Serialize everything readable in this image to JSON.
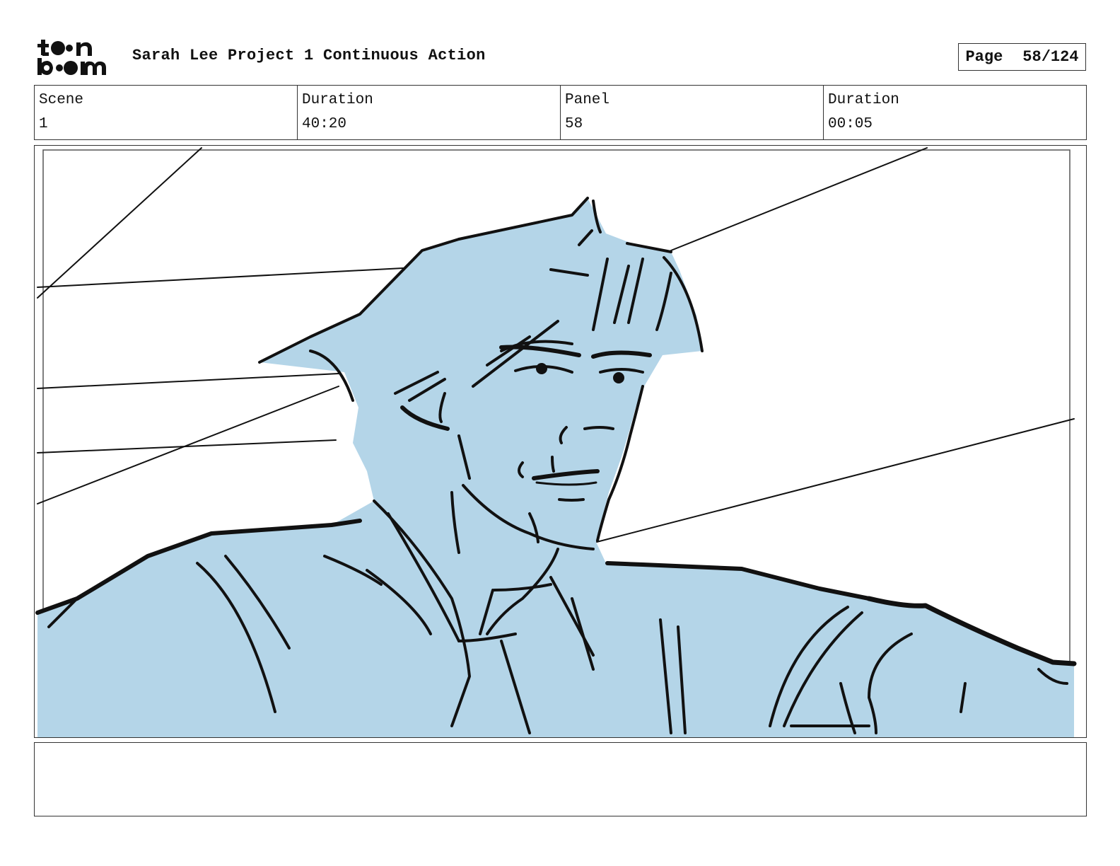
{
  "header": {
    "logo_text": "toon boom",
    "project_title": "Sarah Lee Project 1 Continuous Action",
    "page_label": "Page",
    "page_value": "58/124"
  },
  "info": [
    {
      "label": "Scene",
      "value": "1"
    },
    {
      "label": "Duration",
      "value": "40:20"
    },
    {
      "label": "Panel",
      "value": "58"
    },
    {
      "label": "Duration",
      "value": "00:05"
    }
  ],
  "panel": {
    "description": "",
    "fill_color": "#b4d5e8",
    "line_color": "#111111"
  },
  "notes": {
    "text": ""
  }
}
